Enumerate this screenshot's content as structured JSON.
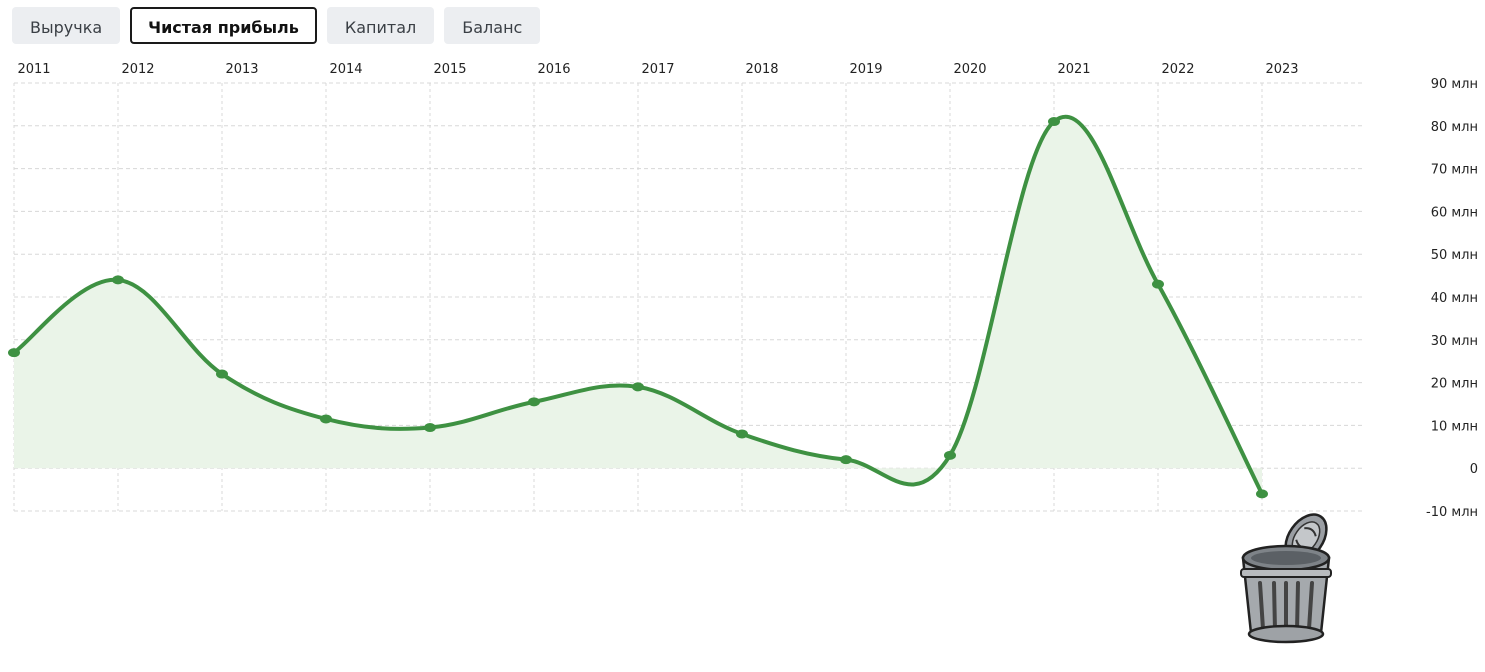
{
  "tabs": [
    {
      "label": "Выручка",
      "active": false
    },
    {
      "label": "Чистая прибыль",
      "active": true
    },
    {
      "label": "Капитал",
      "active": false
    },
    {
      "label": "Баланс",
      "active": false
    }
  ],
  "colors": {
    "line": "#3e9142",
    "fill": "#eaf4e8",
    "grid": "#d8d8d8"
  },
  "icons": {
    "trash": "trash-can-icon"
  },
  "chart_data": {
    "type": "area",
    "title": "",
    "xlabel": "",
    "ylabel": "",
    "x": [
      "2011",
      "2012",
      "2013",
      "2014",
      "2015",
      "2016",
      "2017",
      "2018",
      "2019",
      "2020",
      "2021",
      "2022",
      "2023"
    ],
    "values": [
      27,
      44,
      22,
      11.5,
      9.5,
      15.5,
      19,
      8,
      2,
      3,
      81,
      43,
      -6
    ],
    "ylim": [
      -10,
      90
    ],
    "yticks": [
      {
        "value": 90,
        "label": "90 млн"
      },
      {
        "value": 80,
        "label": "80 млн"
      },
      {
        "value": 70,
        "label": "70 млн"
      },
      {
        "value": 60,
        "label": "60 млн"
      },
      {
        "value": 50,
        "label": "50 млн"
      },
      {
        "value": 40,
        "label": "40 млн"
      },
      {
        "value": 30,
        "label": "30 млн"
      },
      {
        "value": 20,
        "label": "20 млн"
      },
      {
        "value": 10,
        "label": "10 млн"
      },
      {
        "value": 0,
        "label": "0"
      },
      {
        "value": -10,
        "label": "-10 млн"
      }
    ],
    "x_axis_position": "top",
    "y_axis_position": "right",
    "grid": true
  }
}
